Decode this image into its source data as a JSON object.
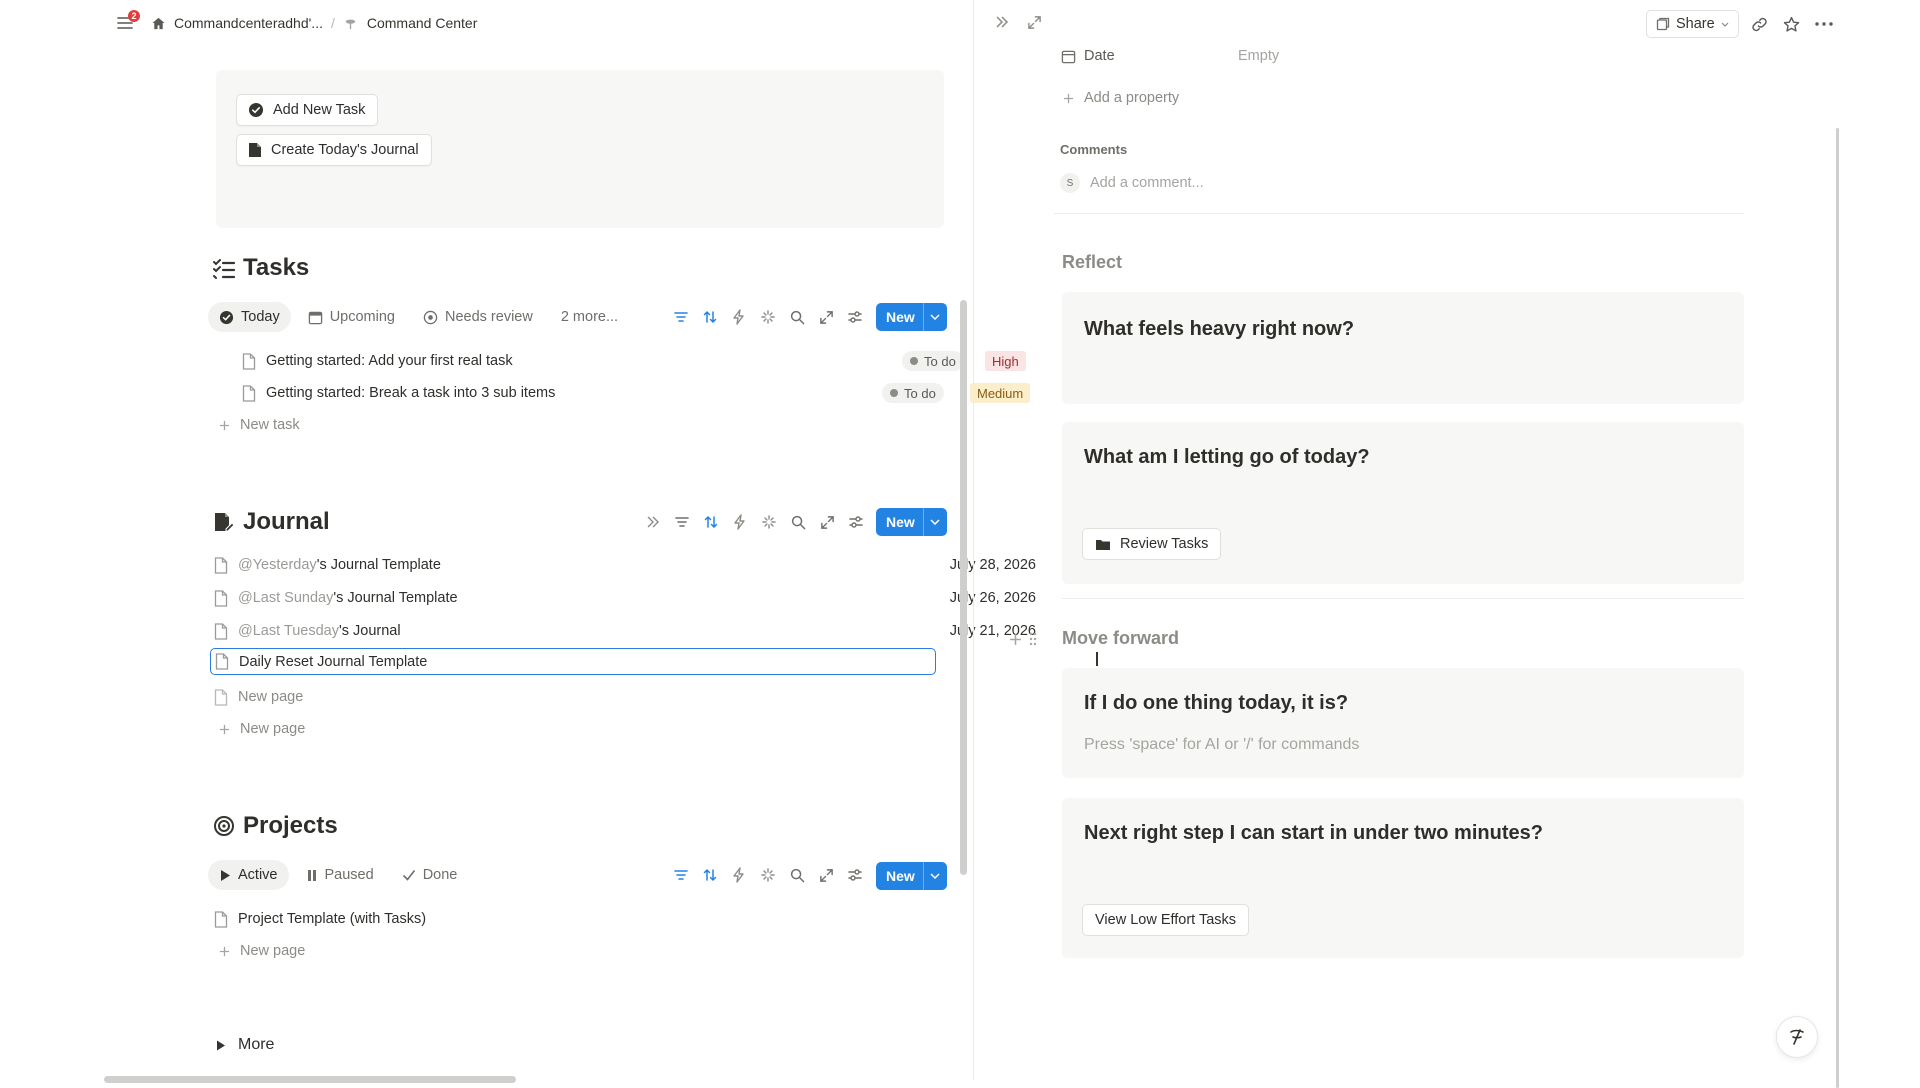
{
  "breadcrumb": {
    "notification_count": "2",
    "workspace": "Commandcenteradhd'...",
    "separator": "/",
    "page": "Command Center"
  },
  "quick_actions": {
    "add_task": "Add New Task",
    "create_journal": "Create Today's Journal"
  },
  "tasks": {
    "title": "Tasks",
    "tabs": [
      {
        "label": "Today",
        "icon": "check-circle-icon"
      },
      {
        "label": "Upcoming",
        "icon": "calendar-icon"
      },
      {
        "label": "Needs review",
        "icon": "review-icon"
      },
      {
        "label": "2 more..."
      }
    ],
    "new_label": "New",
    "rows": [
      {
        "title": "Getting started: Add your first real task",
        "status": "To do",
        "priority": "High",
        "priority_color": "#fbe4e4",
        "priority_text": "#9f2f2d"
      },
      {
        "title": "Getting started: Break a task into 3 sub items",
        "status": "To do",
        "priority": "Medium",
        "priority_color": "#fbeecb",
        "priority_text": "#8a5c15"
      }
    ],
    "add_label": "New task"
  },
  "journal": {
    "title": "Journal",
    "new_label": "New",
    "rows": [
      {
        "mention": "@Yesterday",
        "rest": "'s Journal Template",
        "date": "July 28, 2026"
      },
      {
        "mention": "@Last Sunday",
        "rest": "'s Journal Template",
        "date": "July 26, 2026"
      },
      {
        "mention": "@Last Tuesday",
        "rest": "'s Journal",
        "date": "July 21, 2026"
      }
    ],
    "selected_row": "Daily Reset Journal Template",
    "placeholder_row": "New page",
    "add_label": "New page"
  },
  "projects": {
    "title": "Projects",
    "tabs": [
      {
        "label": "Active",
        "icon": "play-icon"
      },
      {
        "label": "Paused",
        "icon": "pause-icon"
      },
      {
        "label": "Done",
        "icon": "check-icon"
      }
    ],
    "new_label": "New",
    "rows": [
      {
        "title": "Project Template (with Tasks)"
      }
    ],
    "add_label": "New page"
  },
  "more_toggle": "More",
  "panel": {
    "share_label": "Share",
    "date_label": "Date",
    "date_value": "Empty",
    "add_property": "Add a property",
    "comments_label": "Comments",
    "comment_avatar": "S",
    "comment_placeholder": "Add a comment...",
    "reflect_heading": "Reflect",
    "q1": "What feels heavy right now?",
    "q2": "What am I letting go of today?",
    "review_tasks_btn": "Review Tasks",
    "move_forward_heading": "Move forward",
    "q3": "If I do one thing today, it is?",
    "q3_placeholder": "Press 'space' for AI or '/' for commands",
    "q4": "Next right step I can start in under two minutes?",
    "low_effort_btn": "View Low Effort Tasks"
  },
  "colors": {
    "accent": "#2383e2",
    "selection": "#2c7be0",
    "notification": "#e03e3e"
  }
}
